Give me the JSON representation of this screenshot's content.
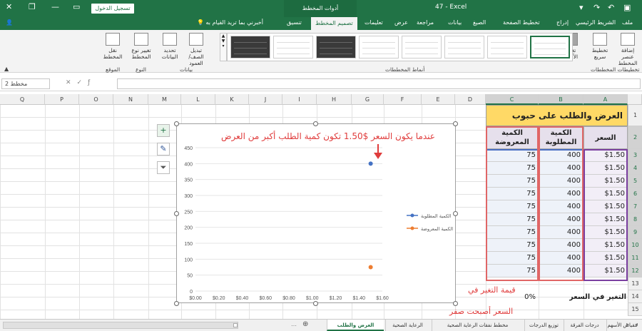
{
  "titlebar": {
    "signin": "تسجيل الدخول",
    "context_group": "أدوات المخطط",
    "app_title": "47 - Excel"
  },
  "tabs": {
    "file": "ملف",
    "home": "الشريط الرئيسي",
    "insert": "إدراج",
    "layout": "تخطيط الصفحة",
    "formulas": "الصيغ",
    "data": "بيانات",
    "review": "مراجعة",
    "view": "عرض",
    "help": "تعليمات",
    "design": "تصميم المخطط",
    "format": "تنسيق",
    "tellme": "أخبرني بما تريد القيام به"
  },
  "ribbon": {
    "add_element": "إضافة عنصر المخطط",
    "quick_layout": "تخطيط سريع",
    "change_colors": "تغيير الألوان",
    "layouts_group": "تخطيطات المخططات",
    "styles_group": "أنماط المخططات",
    "switch_row_col": "تبديل الصف/ العمود",
    "select_data": "تحديد البيانات",
    "data_group": "بيانات",
    "change_type": "تغيير نوع المخطط",
    "type_group": "النوع",
    "move_chart": "نقل المخطط",
    "location_group": "الموقع"
  },
  "formula_bar": {
    "namebox": "مخطط 2"
  },
  "columns": [
    "A",
    "B",
    "C",
    "D",
    "E",
    "F",
    "G",
    "H",
    "I",
    "J",
    "K",
    "L",
    "M",
    "N",
    "O",
    "P",
    "Q"
  ],
  "rows": [
    "1",
    "2",
    "3",
    "4",
    "5",
    "6",
    "7",
    "8",
    "9",
    "10",
    "11",
    "12",
    "13",
    "14",
    "15"
  ],
  "table": {
    "title": "العرض والطلب على حبوب الإفطار",
    "header_price": "السعر",
    "header_demand": "الكمية المطلوبة",
    "header_supply": "الكمية المعروضة",
    "rows": [
      {
        "price": "$1.50",
        "demand": "400",
        "supply": "75"
      },
      {
        "price": "$1.50",
        "demand": "400",
        "supply": "75"
      },
      {
        "price": "$1.50",
        "demand": "400",
        "supply": "75"
      },
      {
        "price": "$1.50",
        "demand": "400",
        "supply": "75"
      },
      {
        "price": "$1.50",
        "demand": "400",
        "supply": "75"
      },
      {
        "price": "$1.50",
        "demand": "400",
        "supply": "75"
      },
      {
        "price": "$1.50",
        "demand": "400",
        "supply": "75"
      },
      {
        "price": "$1.50",
        "demand": "400",
        "supply": "75"
      },
      {
        "price": "$1.50",
        "demand": "400",
        "supply": "75"
      },
      {
        "price": "$1.50",
        "demand": "400",
        "supply": "75"
      }
    ],
    "change_label": "التغير في السعر",
    "change_value": "0%"
  },
  "annotations": {
    "chart_note": "عندما يكون السعر $1.50 تكون كمية الطلب أكبر من العرض",
    "change_note": "قيمة التغير في",
    "change_note2": "السعر أصبحت صفر"
  },
  "chart_data": {
    "type": "scatter",
    "xlim": [
      0,
      1.6
    ],
    "ylim": [
      0,
      450
    ],
    "xticks": [
      "$0.00",
      "$0.20",
      "$0.40",
      "$0.60",
      "$0.80",
      "$1.00",
      "$1.20",
      "$1.40",
      "$1.60"
    ],
    "yticks": [
      "0",
      "50",
      "100",
      "150",
      "200",
      "250",
      "300",
      "350",
      "400",
      "450"
    ],
    "series": [
      {
        "name": "الكمية المطلوبة",
        "color": "#4472c4",
        "points": [
          {
            "x": 1.5,
            "y": 400
          }
        ]
      },
      {
        "name": "الكمية المعروضة",
        "color": "#ed7d31",
        "points": [
          {
            "x": 1.5,
            "y": 75
          }
        ]
      }
    ]
  },
  "sheet_tabs": [
    "مقياس الأسهم",
    "درجات الفرقة",
    "توزيع الدرجات",
    "مخطط نفقات الرعاية الصحية",
    "الرعاية الصحية",
    "العرض والطلب"
  ]
}
